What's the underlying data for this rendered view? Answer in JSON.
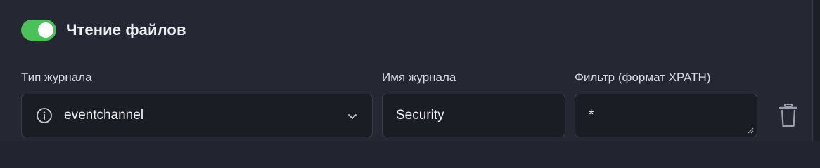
{
  "section": {
    "title": "Чтение файлов",
    "enabled": true
  },
  "fields": {
    "log_type": {
      "label": "Тип журнала",
      "value": "eventchannel",
      "icon": "info-icon"
    },
    "log_name": {
      "label": "Имя журнала",
      "value": "Security"
    },
    "filter": {
      "label": "Фильтр (формат XPATH)",
      "value": "*"
    }
  },
  "colors": {
    "toggle_on": "#4cc15a",
    "panel_bg": "#252833",
    "input_bg": "#1b1d25"
  }
}
